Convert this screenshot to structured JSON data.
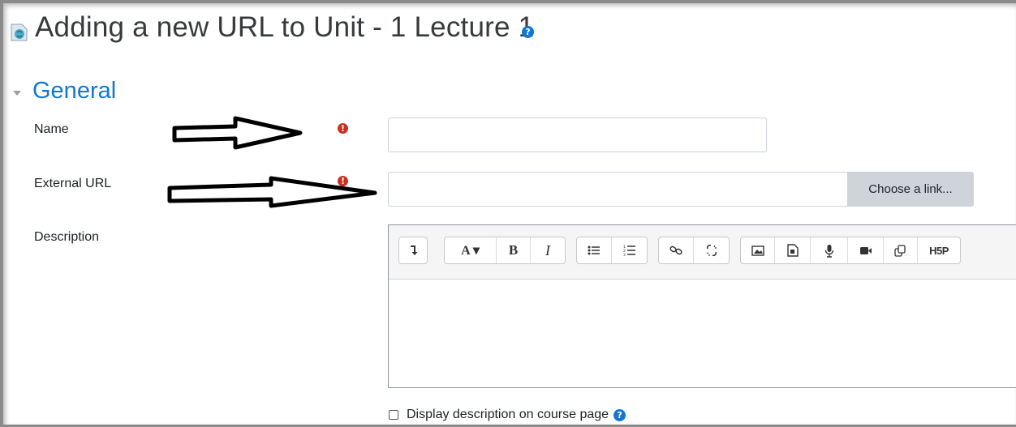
{
  "page": {
    "title": "Adding a new URL to Unit - 1 Lecture 1",
    "help_icon": "question-circle-icon"
  },
  "section": {
    "title": "General",
    "toggle_icon": "caret-down-icon"
  },
  "fields": {
    "name": {
      "label": "Name",
      "value": "",
      "required": true
    },
    "external_url": {
      "label": "External URL",
      "value": "",
      "required": true,
      "choose_link_label": "Choose a link..."
    },
    "description": {
      "label": "Description",
      "value": ""
    }
  },
  "editor": {
    "toolbar": [
      {
        "name": "more-options-icon",
        "label": ""
      },
      {
        "name": "font-style-icon",
        "label": "A ▾"
      },
      {
        "name": "bold-icon",
        "label": "B"
      },
      {
        "name": "italic-icon",
        "label": "I"
      },
      {
        "name": "unordered-list-icon",
        "label": ""
      },
      {
        "name": "ordered-list-icon",
        "label": ""
      },
      {
        "name": "link-icon",
        "label": ""
      },
      {
        "name": "unlink-icon",
        "label": ""
      },
      {
        "name": "image-icon",
        "label": ""
      },
      {
        "name": "media-icon",
        "label": ""
      },
      {
        "name": "record-audio-icon",
        "label": ""
      },
      {
        "name": "record-video-icon",
        "label": ""
      },
      {
        "name": "manage-files-icon",
        "label": ""
      },
      {
        "name": "h5p-icon",
        "label": "H5P"
      }
    ]
  },
  "display_description": {
    "label": "Display description on course page",
    "checked": false
  },
  "colors": {
    "accent": "#1177d1",
    "required": "#ca3120",
    "button_bg": "#ced4da"
  }
}
